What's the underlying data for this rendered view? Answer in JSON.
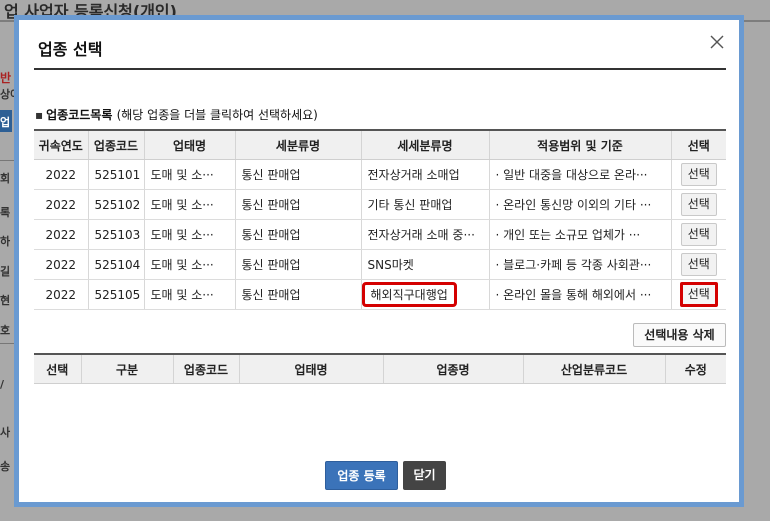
{
  "background": {
    "title": "업 사업자 등록신청(개인)",
    "side_fragments": [
      "반",
      "상여",
      "업",
      "회",
      "록",
      "하",
      "길",
      "현",
      "호",
      "/",
      "사",
      "송"
    ]
  },
  "modal": {
    "title": "업종 선택",
    "close_icon": "close-icon",
    "section_label": "업종코드목록",
    "section_hint": "(해당 업종을 더블 클릭하여 선택하세요)",
    "codes_table": {
      "headers": [
        "귀속연도",
        "업종코드",
        "업태명",
        "세분류명",
        "세세분류명",
        "적용범위 및 기준",
        "선택"
      ],
      "rows": [
        {
          "year": "2022",
          "code": "525101",
          "business_type": "도매 및 소···",
          "sub_class": "통신 판매업",
          "detail_class": "전자상거래 소매업",
          "scope": "· 일반 대중을 대상으로 온라···",
          "select": "선택"
        },
        {
          "year": "2022",
          "code": "525102",
          "business_type": "도매 및 소···",
          "sub_class": "통신 판매업",
          "detail_class": "기타 통신 판매업",
          "scope": "· 온라인 통신망 이외의 기타 ···",
          "select": "선택"
        },
        {
          "year": "2022",
          "code": "525103",
          "business_type": "도매 및 소···",
          "sub_class": "통신 판매업",
          "detail_class": "전자상거래 소매 중···",
          "scope": "· 개인 또는 소규모 업체가 ···",
          "select": "선택"
        },
        {
          "year": "2022",
          "code": "525104",
          "business_type": "도매 및 소···",
          "sub_class": "통신 판매업",
          "detail_class": "SNS마켓",
          "scope": "· 블로그·카페 등 각종 사회관···",
          "select": "선택"
        },
        {
          "year": "2022",
          "code": "525105",
          "business_type": "도매 및 소···",
          "sub_class": "통신 판매업",
          "detail_class": "해외직구대행업",
          "scope": "·  온라인 몰을 통해 해외에서 ···",
          "select": "선택"
        }
      ]
    },
    "delete_button": "선택내용 삭제",
    "selected_table": {
      "headers": [
        "선택",
        "구분",
        "업종코드",
        "업태명",
        "업종명",
        "산업분류코드",
        "수정"
      ]
    },
    "register_button": "업종 등록",
    "close_button": "닫기",
    "highlight_color": "#d40000",
    "accent_color": "#3b73b9"
  }
}
